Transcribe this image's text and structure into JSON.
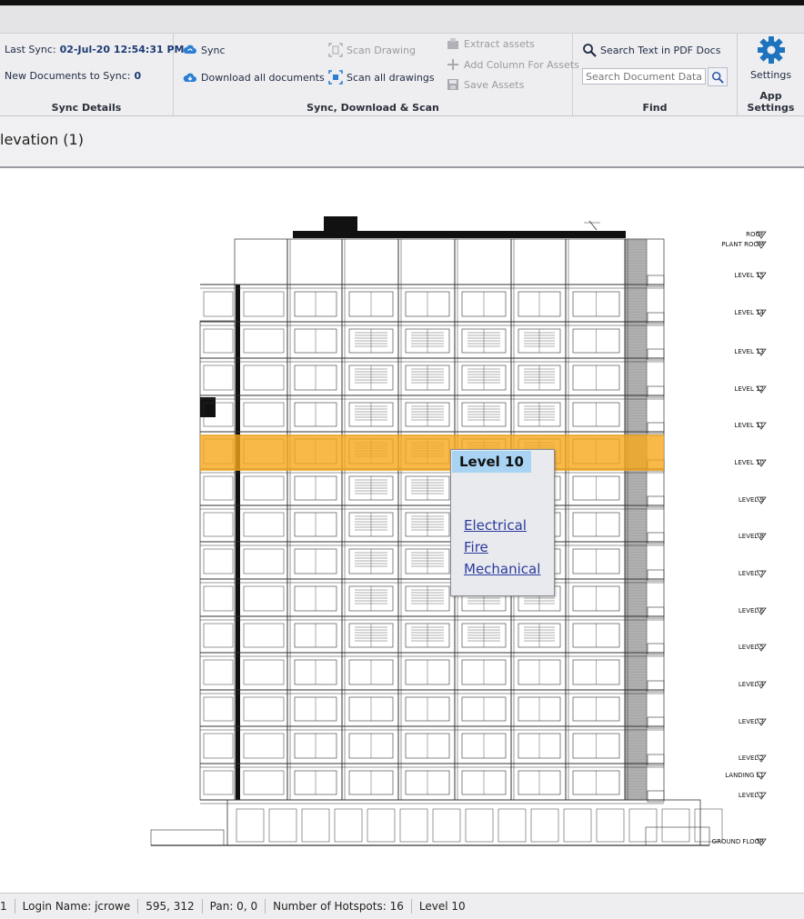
{
  "ribbon": {
    "sync_details": {
      "last_sync_label": "Last Sync:",
      "last_sync_value": "02-Jul-20 12:54:31 PM",
      "new_docs_label": "New Documents to Sync:",
      "new_docs_value": "0",
      "group_label": "Sync Details"
    },
    "sync_group": {
      "sync": "Sync",
      "download_all": "Download all documents",
      "scan_drawing": "Scan Drawing",
      "scan_all": "Scan all drawings",
      "extract_assets": "Extract assets",
      "add_column": "Add Column For Assets",
      "save_assets": "Save Assets",
      "group_label": "Sync, Download & Scan"
    },
    "find": {
      "search_text_label": "Search Text in PDF Docs",
      "search_placeholder": "Search Document Data",
      "group_label": "Find"
    },
    "app_settings": {
      "settings_label": "Settings",
      "group_label": "App Settings"
    }
  },
  "document": {
    "title": "levation (1)"
  },
  "drawing": {
    "levels": [
      "ROOF",
      "PLANT ROOM",
      "LEVEL 15",
      "LEVEL 14",
      "LEVEL 13",
      "LEVEL 12",
      "LEVEL 11",
      "LEVEL 10",
      "LEVEL 9",
      "LEVEL 8",
      "LEVEL 7",
      "LEVEL 6",
      "LEVEL 5",
      "LEVEL 4",
      "LEVEL 3",
      "LEVEL 2",
      "LANDING L1",
      "LEVEL 1",
      "GROUND FLOOR"
    ],
    "highlight_color": "#f7a81b"
  },
  "popup": {
    "title": "Level 10",
    "links": [
      "Electrical",
      "Fire",
      "Mechanical"
    ]
  },
  "status": {
    "first": "1",
    "login": "Login Name: jcrowe",
    "coords": "595, 312",
    "pan": "Pan: 0, 0",
    "hotspots": "Number of Hotspots: 16",
    "level": "Level 10"
  },
  "colors": {
    "accent": "#1e73be",
    "ribbon_bg": "#eeeef0",
    "popup_header": "#a9d3f2"
  }
}
